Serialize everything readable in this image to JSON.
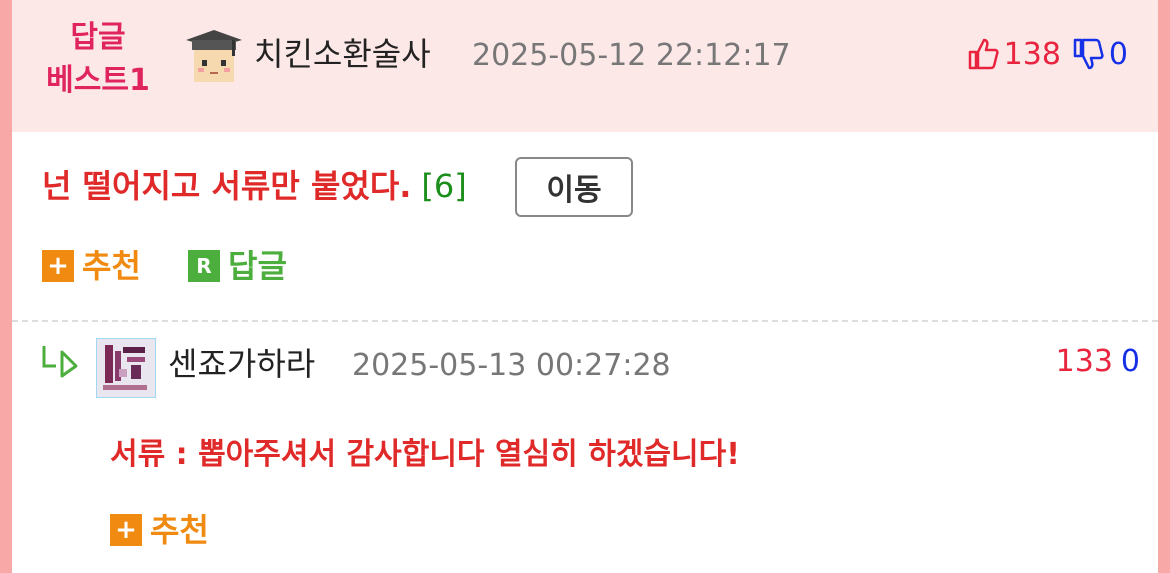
{
  "post": {
    "badge_line1": "답글",
    "badge_line2": "베스트1",
    "author": "치킨소환술사",
    "datetime": "2025-05-12 22:12:17",
    "upvotes": "138",
    "downvotes": "0",
    "title": "넌 떨어지고 서류만 붙었다.",
    "comment_count": "[6]",
    "move_label": "이동",
    "recommend_label": "추천",
    "reply_label": "답글",
    "recommend_icon": "+",
    "reply_icon": "R"
  },
  "reply": {
    "author": "센죠가하라",
    "datetime": "2025-05-13 00:27:28",
    "upvotes": "133",
    "downvotes": "0",
    "text": "서류 : 뽑아주셔서 감사합니다 열심히 하겠습니다!",
    "recommend_label": "추천",
    "recommend_icon": "+"
  },
  "colors": {
    "accent_red": "#e02a2a",
    "badge_pink": "#e0245e",
    "orange": "#f08a10",
    "green": "#4cae3c",
    "down_blue": "#1530e6"
  },
  "icons": {
    "upvote": "thumbs-up-icon",
    "downvote": "thumbs-down-icon",
    "reply_arrow": "reply-arrow-icon"
  }
}
